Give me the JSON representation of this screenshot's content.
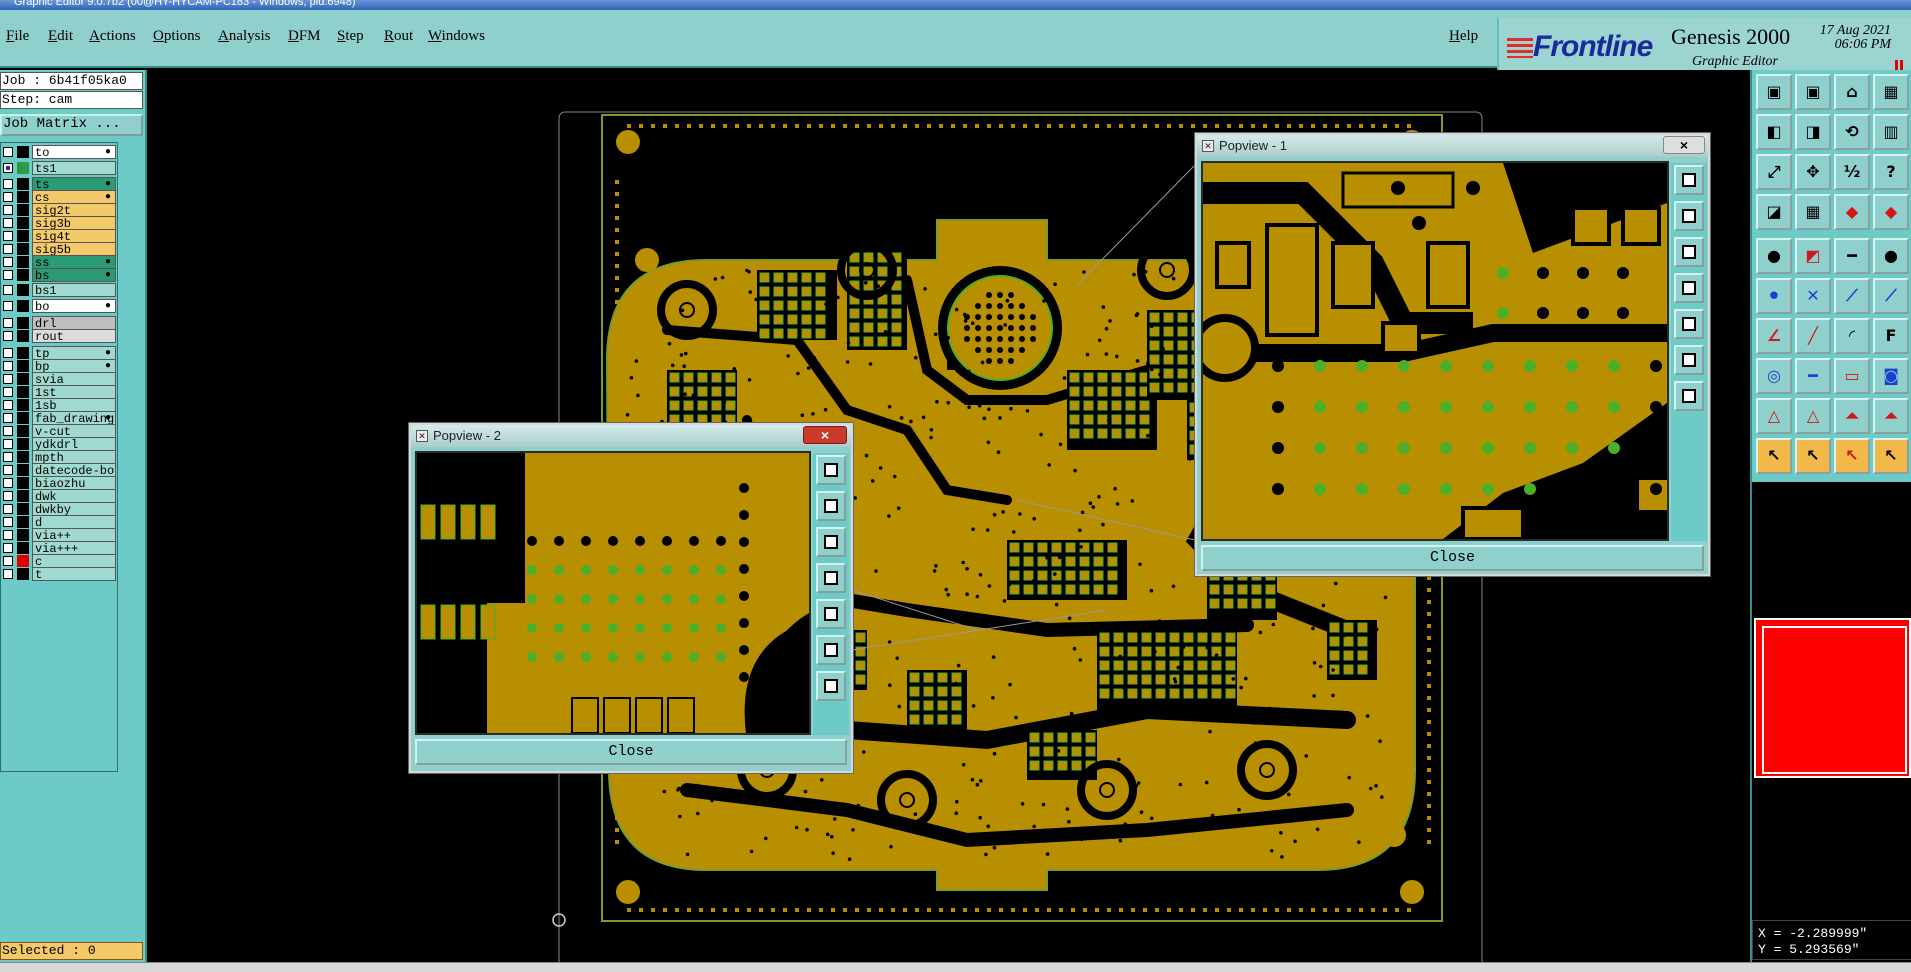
{
  "window": {
    "title": "Graphic Editor 9.0.7b2 (00@HY-HYCAM-PC183 - Windows, pid:6948)"
  },
  "menu": {
    "items": [
      "File",
      "Edit",
      "Actions",
      "Options",
      "Analysis",
      "DFM",
      "Step",
      "Rout",
      "Windows"
    ],
    "help": "Help"
  },
  "brand": {
    "logo": "Frontline",
    "product": "Genesis 2000",
    "subtitle": "Graphic Editor",
    "date": "17 Aug 2021",
    "time": "06:06 PM"
  },
  "job": {
    "job_line": "Job : 6b41f05ka0",
    "step_line": "Step: cam",
    "matrix_button": "Job Matrix ...",
    "selected": "Selected : 0"
  },
  "layers": [
    {
      "name": "to",
      "bg": "#ffffff",
      "swatch": "#000000",
      "flag": "●"
    },
    {
      "name": "ts1",
      "bg": "#9fd9cf",
      "swatch": "#2d9a45",
      "flag": "",
      "checked": true
    },
    {
      "name": "ts",
      "bg": "#2d9a77",
      "swatch": "#000000",
      "flag": "●"
    },
    {
      "name": "cs",
      "bg": "#f4c96a",
      "swatch": "#000000",
      "flag": "●"
    },
    {
      "name": "sig2t",
      "bg": "#f4c96a",
      "swatch": "#000000",
      "flag": ""
    },
    {
      "name": "sig3b",
      "bg": "#f4c96a",
      "swatch": "#000000",
      "flag": ""
    },
    {
      "name": "sig4t",
      "bg": "#f4c96a",
      "swatch": "#000000",
      "flag": ""
    },
    {
      "name": "sig5b",
      "bg": "#f4c96a",
      "swatch": "#000000",
      "flag": ""
    },
    {
      "name": "ss",
      "bg": "#2d9a77",
      "swatch": "#000000",
      "flag": "●"
    },
    {
      "name": "bs",
      "bg": "#2d9a77",
      "swatch": "#000000",
      "flag": "●"
    },
    {
      "name": "bs1",
      "bg": "#9fd9cf",
      "swatch": "#000000",
      "flag": ""
    },
    {
      "name": "bo",
      "bg": "#ffffff",
      "swatch": "#000000",
      "flag": "●"
    },
    {
      "name": "drl",
      "bg": "#bfbfbf",
      "swatch": "#000000",
      "flag": ""
    },
    {
      "name": "rout",
      "bg": "#dcdcdc",
      "swatch": "#000000",
      "flag": ""
    },
    {
      "name": "tp",
      "bg": "#9fd9cf",
      "swatch": "#000000",
      "flag": "●"
    },
    {
      "name": "bp",
      "bg": "#9fd9cf",
      "swatch": "#000000",
      "flag": "●"
    },
    {
      "name": "svia",
      "bg": "#9fd9cf",
      "swatch": "#000000",
      "flag": ""
    },
    {
      "name": "1st",
      "bg": "#9fd9cf",
      "swatch": "#000000",
      "flag": ""
    },
    {
      "name": "1sb",
      "bg": "#9fd9cf",
      "swatch": "#000000",
      "flag": ""
    },
    {
      "name": "fab_drawing",
      "bg": "#9fd9cf",
      "swatch": "#000000",
      "flag": "●"
    },
    {
      "name": "v-cut",
      "bg": "#9fd9cf",
      "swatch": "#000000",
      "flag": ""
    },
    {
      "name": "ydkdrl",
      "bg": "#9fd9cf",
      "swatch": "#000000",
      "flag": ""
    },
    {
      "name": "mpth",
      "bg": "#9fd9cf",
      "swatch": "#000000",
      "flag": ""
    },
    {
      "name": "datecode-bo",
      "bg": "#9fd9cf",
      "swatch": "#000000",
      "flag": ""
    },
    {
      "name": "biaozhu",
      "bg": "#9fd9cf",
      "swatch": "#000000",
      "flag": ""
    },
    {
      "name": "dwk",
      "bg": "#9fd9cf",
      "swatch": "#000000",
      "flag": ""
    },
    {
      "name": "dwkby",
      "bg": "#9fd9cf",
      "swatch": "#000000",
      "flag": ""
    },
    {
      "name": "d",
      "bg": "#9fd9cf",
      "swatch": "#000000",
      "flag": ""
    },
    {
      "name": "via++",
      "bg": "#9fd9cf",
      "swatch": "#000000",
      "flag": ""
    },
    {
      "name": "via+++",
      "bg": "#9fd9cf",
      "swatch": "#000000",
      "flag": ""
    },
    {
      "name": "c",
      "bg": "#9fd9cf",
      "swatch": "#e00000",
      "flag": ""
    },
    {
      "name": "t",
      "bg": "#9fd9cf",
      "swatch": "#000000",
      "flag": ""
    }
  ],
  "popup1": {
    "title": "Popview - 1",
    "close": "Close"
  },
  "popup2": {
    "title": "Popview - 2",
    "close": "Close"
  },
  "coords": {
    "x": "X = -2.289999\"",
    "y": "Y = 5.293569\""
  },
  "colors": {
    "copper": "#b88f00",
    "panel": "#8fd0cd",
    "panel_dark": "#6ccbc6",
    "pad_green": "#4caf2a",
    "outline": "#7c9a2e"
  }
}
